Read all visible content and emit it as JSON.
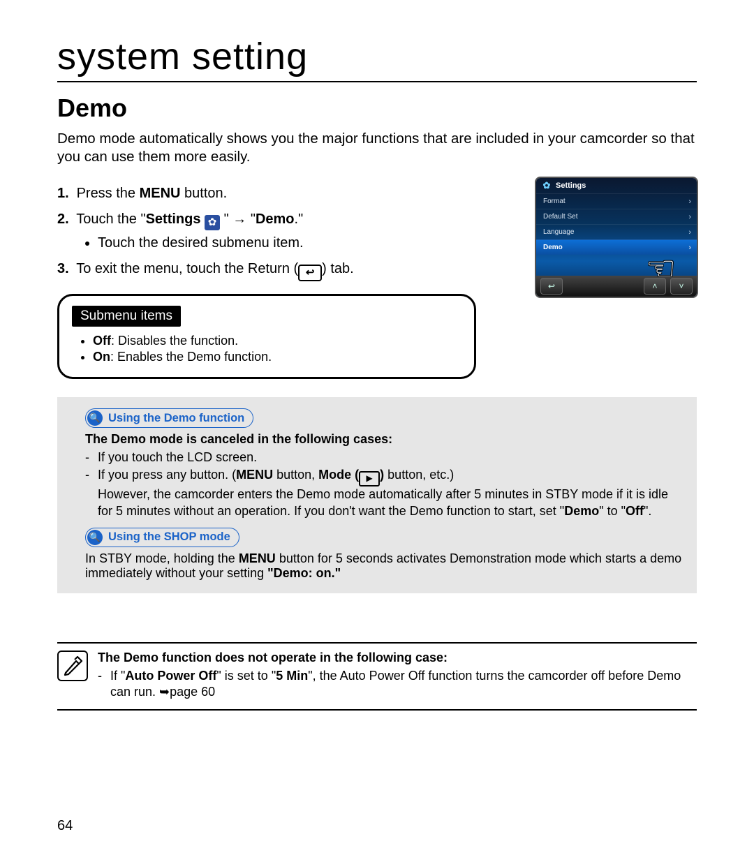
{
  "breadcrumb": "system setting",
  "section_title": "Demo",
  "intro": "Demo mode automatically shows you the major functions that are included in your camcorder so that you can use them more easily.",
  "steps": {
    "s1_a": "Press the ",
    "s1_b": "MENU",
    "s1_c": " button.",
    "s2_a": "Touch the \"",
    "s2_b": "Settings",
    "s2_c": " \"  →  \"",
    "s2_d": "Demo",
    "s2_e": ".\"",
    "s2_sub": "Touch the desired submenu item.",
    "s3_a": "To exit the menu, touch the Return (",
    "s3_b": ") tab."
  },
  "submenu": {
    "title": "Submenu items",
    "off_b": "Off",
    "off_t": ": Disables the function.",
    "on_b": "On",
    "on_t": ": Enables the Demo function."
  },
  "screenshot": {
    "title": "Settings",
    "items": [
      "Format",
      "Default Set",
      "Language",
      "Demo"
    ]
  },
  "tip1": {
    "tag": "Using the Demo function",
    "heading": "The Demo mode is canceled in the following cases:",
    "li1": "If you touch the LCD screen.",
    "li2_a": "If you press any button. (",
    "li2_b": "MENU",
    "li2_c": " button, ",
    "li2_d": "Mode (",
    "li2_e": ")",
    "li2_f": " button, etc.)",
    "li2_cont_a": "However, the camcorder enters the Demo mode automatically after 5 minutes in STBY mode if it is idle for 5 minutes without an operation. If you don't want the Demo function to start, set \"",
    "li2_cont_b": "Demo",
    "li2_cont_c": "\" to \"",
    "li2_cont_d": "Off",
    "li2_cont_e": "\"."
  },
  "tip2": {
    "tag": "Using the SHOP mode",
    "text_a": "In STBY mode, holding the ",
    "text_b": "MENU",
    "text_c": " button for 5 seconds activates Demonstration mode which starts a demo immediately without your setting ",
    "text_d": "\"Demo: on.\""
  },
  "note": {
    "heading": "The Demo function does not operate in the following case:",
    "li_a": "If \"",
    "li_b": "Auto Power Off",
    "li_c": "\" is set to \"",
    "li_d": "5 Min",
    "li_e": "\", the Auto Power Off function turns the camcorder off before Demo can run. ➥page 60"
  },
  "page_number": "64"
}
